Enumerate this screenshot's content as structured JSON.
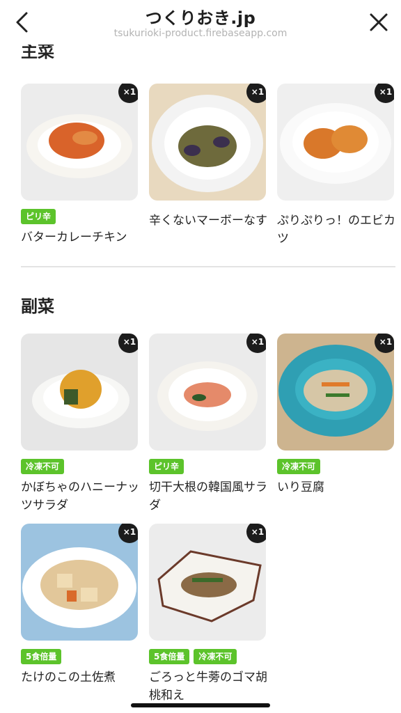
{
  "header": {
    "title": "つくりおき.jp",
    "url": "tsukurioki-product.firebaseapp.com",
    "back_icon": "chevron-left-icon",
    "close_icon": "close-icon"
  },
  "sections": [
    {
      "title": "主菜",
      "items": [
        {
          "name": "バターカレーチキン",
          "tags": [
            "ピリ辛"
          ],
          "qty": "×1"
        },
        {
          "name": "辛くないマーボーなす",
          "tags": [],
          "qty": "×1"
        },
        {
          "name": "ぷりぷりっ！のエビカツ",
          "tags": [],
          "qty": "×1"
        }
      ]
    },
    {
      "title": "副菜",
      "items": [
        {
          "name": "かぼちゃのハニーナッツサラダ",
          "tags": [
            "冷凍不可"
          ],
          "qty": "×1"
        },
        {
          "name": "切干大根の韓国風サラダ",
          "tags": [
            "ピリ辛"
          ],
          "qty": "×1"
        },
        {
          "name": "いり豆腐",
          "tags": [
            "冷凍不可"
          ],
          "qty": "×1"
        },
        {
          "name": "たけのこの土佐煮",
          "tags": [
            "5食倍量"
          ],
          "qty": "×1"
        },
        {
          "name": "ごろっと牛蒡のゴマ胡桃和え",
          "tags": [
            "5食倍量",
            "冷凍不可"
          ],
          "qty": "×1"
        }
      ]
    }
  ],
  "colors": {
    "tag_green": "#5cc32b",
    "badge_dark": "#1c1c1c"
  }
}
